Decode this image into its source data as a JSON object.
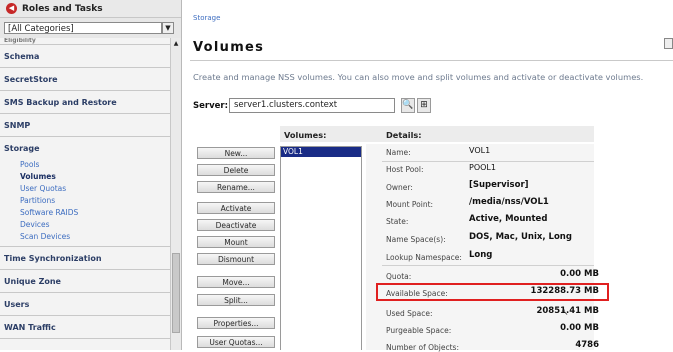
{
  "sidebar": {
    "title": "Roles and Tasks",
    "category_select": "[All Categories]",
    "faded_item": "Eligibility",
    "categories": {
      "schema": "Schema",
      "secretstore": "SecretStore",
      "sms": "SMS Backup and Restore",
      "snmp": "SNMP",
      "storage": "Storage",
      "time_sync": "Time Synchronization",
      "unique_zone": "Unique Zone",
      "users": "Users",
      "wan": "WAN Traffic"
    },
    "storage_items": [
      "Pools",
      "Volumes",
      "User Quotas",
      "Partitions",
      "Software RAIDS",
      "Devices",
      "Scan Devices"
    ]
  },
  "breadcrumb": "Storage",
  "page": {
    "title": "Volumes",
    "description": "Create and manage NSS volumes. You can also move and split volumes and activate or deactivate volumes."
  },
  "server": {
    "label": "Server:",
    "value": "server1.clusters.context"
  },
  "columns": {
    "volumes": "Volumes:",
    "details": "Details:"
  },
  "buttons": {
    "new": "New...",
    "delete": "Delete",
    "rename": "Rename...",
    "activate": "Activate",
    "deactivate": "Deactivate",
    "mount": "Mount",
    "dismount": "Dismount",
    "move": "Move...",
    "split": "Split...",
    "properties": "Properties...",
    "user_quotas": "User Quotas..."
  },
  "volumes": [
    "VOL1"
  ],
  "details": {
    "name_label": "Name:",
    "name": "VOL1",
    "pool_label": "Host Pool:",
    "pool": "POOL1",
    "owner_label": "Owner:",
    "owner": "[Supervisor]",
    "mount_label": "Mount Point:",
    "mount": "/media/nss/VOL1",
    "state_label": "State:",
    "state": "Active, Mounted",
    "ns_label": "Name Space(s):",
    "ns": "DOS, Mac, Unix, Long",
    "lookup_label": "Lookup Namespace:",
    "lookup": "Long",
    "quota_label": "Quota:",
    "quota": "0.00 MB",
    "avail_label": "Available Space:",
    "avail": "132288.73 MB",
    "used_label": "Used Space:",
    "used": "20851.41 MB",
    "purge_label": "Purgeable Space:",
    "purge": "0.00 MB",
    "objects_label": "Number of Objects:",
    "objects": "4786"
  },
  "colors": {
    "highlight": "#e02020",
    "selection": "#1a2c86",
    "link": "#3d6dc0"
  }
}
